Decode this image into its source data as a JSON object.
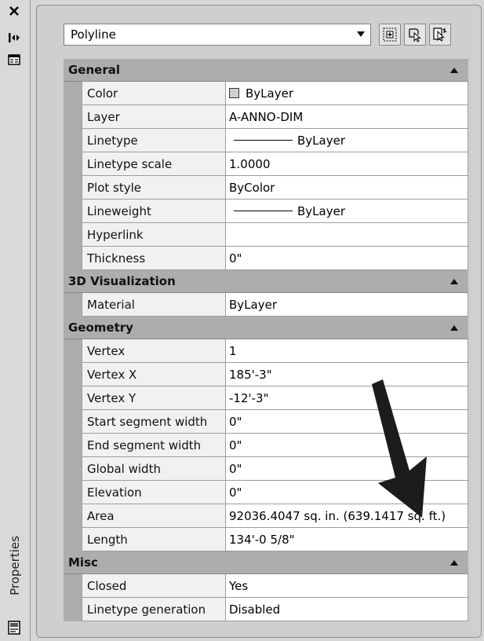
{
  "palette": {
    "title": "Properties",
    "object_type": "Polyline",
    "toolbar_buttons": [
      "toggle-pickadd-icon",
      "select-objects-icon",
      "quick-select-icon"
    ],
    "categories": [
      {
        "label": "General",
        "rows": [
          {
            "name": "Color",
            "value": "ByLayer",
            "swatch": true
          },
          {
            "name": "Layer",
            "value": "A-ANNO-DIM"
          },
          {
            "name": "Linetype",
            "value": "ByLayer",
            "line": true
          },
          {
            "name": "Linetype scale",
            "value": "1.0000"
          },
          {
            "name": "Plot style",
            "value": "ByColor"
          },
          {
            "name": "Lineweight",
            "value": "ByLayer",
            "line": true
          },
          {
            "name": "Hyperlink",
            "value": ""
          },
          {
            "name": "Thickness",
            "value": "0\""
          }
        ]
      },
      {
        "label": "3D Visualization",
        "rows": [
          {
            "name": "Material",
            "value": "ByLayer"
          }
        ]
      },
      {
        "label": "Geometry",
        "rows": [
          {
            "name": "Vertex",
            "value": "1"
          },
          {
            "name": "Vertex X",
            "value": "185'-3\""
          },
          {
            "name": "Vertex Y",
            "value": "-12'-3\""
          },
          {
            "name": "Start segment width",
            "value": "0\""
          },
          {
            "name": "End segment width",
            "value": "0\""
          },
          {
            "name": "Global width",
            "value": "0\""
          },
          {
            "name": "Elevation",
            "value": "0\""
          },
          {
            "name": "Area",
            "value": "92036.4047 sq. in. (639.1417 sq. ft.)"
          },
          {
            "name": "Length",
            "value": "134'-0 5/8\""
          }
        ]
      },
      {
        "label": "Misc",
        "rows": [
          {
            "name": "Closed",
            "value": "Yes"
          },
          {
            "name": "Linetype generation",
            "value": "Disabled"
          }
        ]
      }
    ]
  }
}
